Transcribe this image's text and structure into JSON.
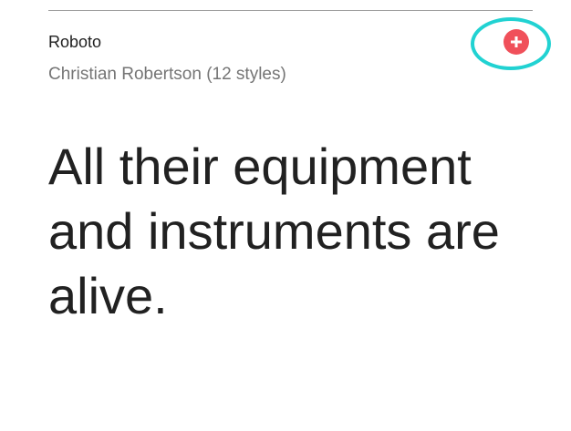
{
  "font_card": {
    "name": "Roboto",
    "meta": "Christian Robertson (12 styles)",
    "sample_text": "All their equipment and instruments are alive.",
    "add_icon": "plus-icon",
    "colors": {
      "add_button": "#f0505a",
      "highlight_ring": "#21d2d2",
      "divider": "#9e9e9e",
      "name_text": "#212121",
      "meta_text": "#757575"
    }
  }
}
